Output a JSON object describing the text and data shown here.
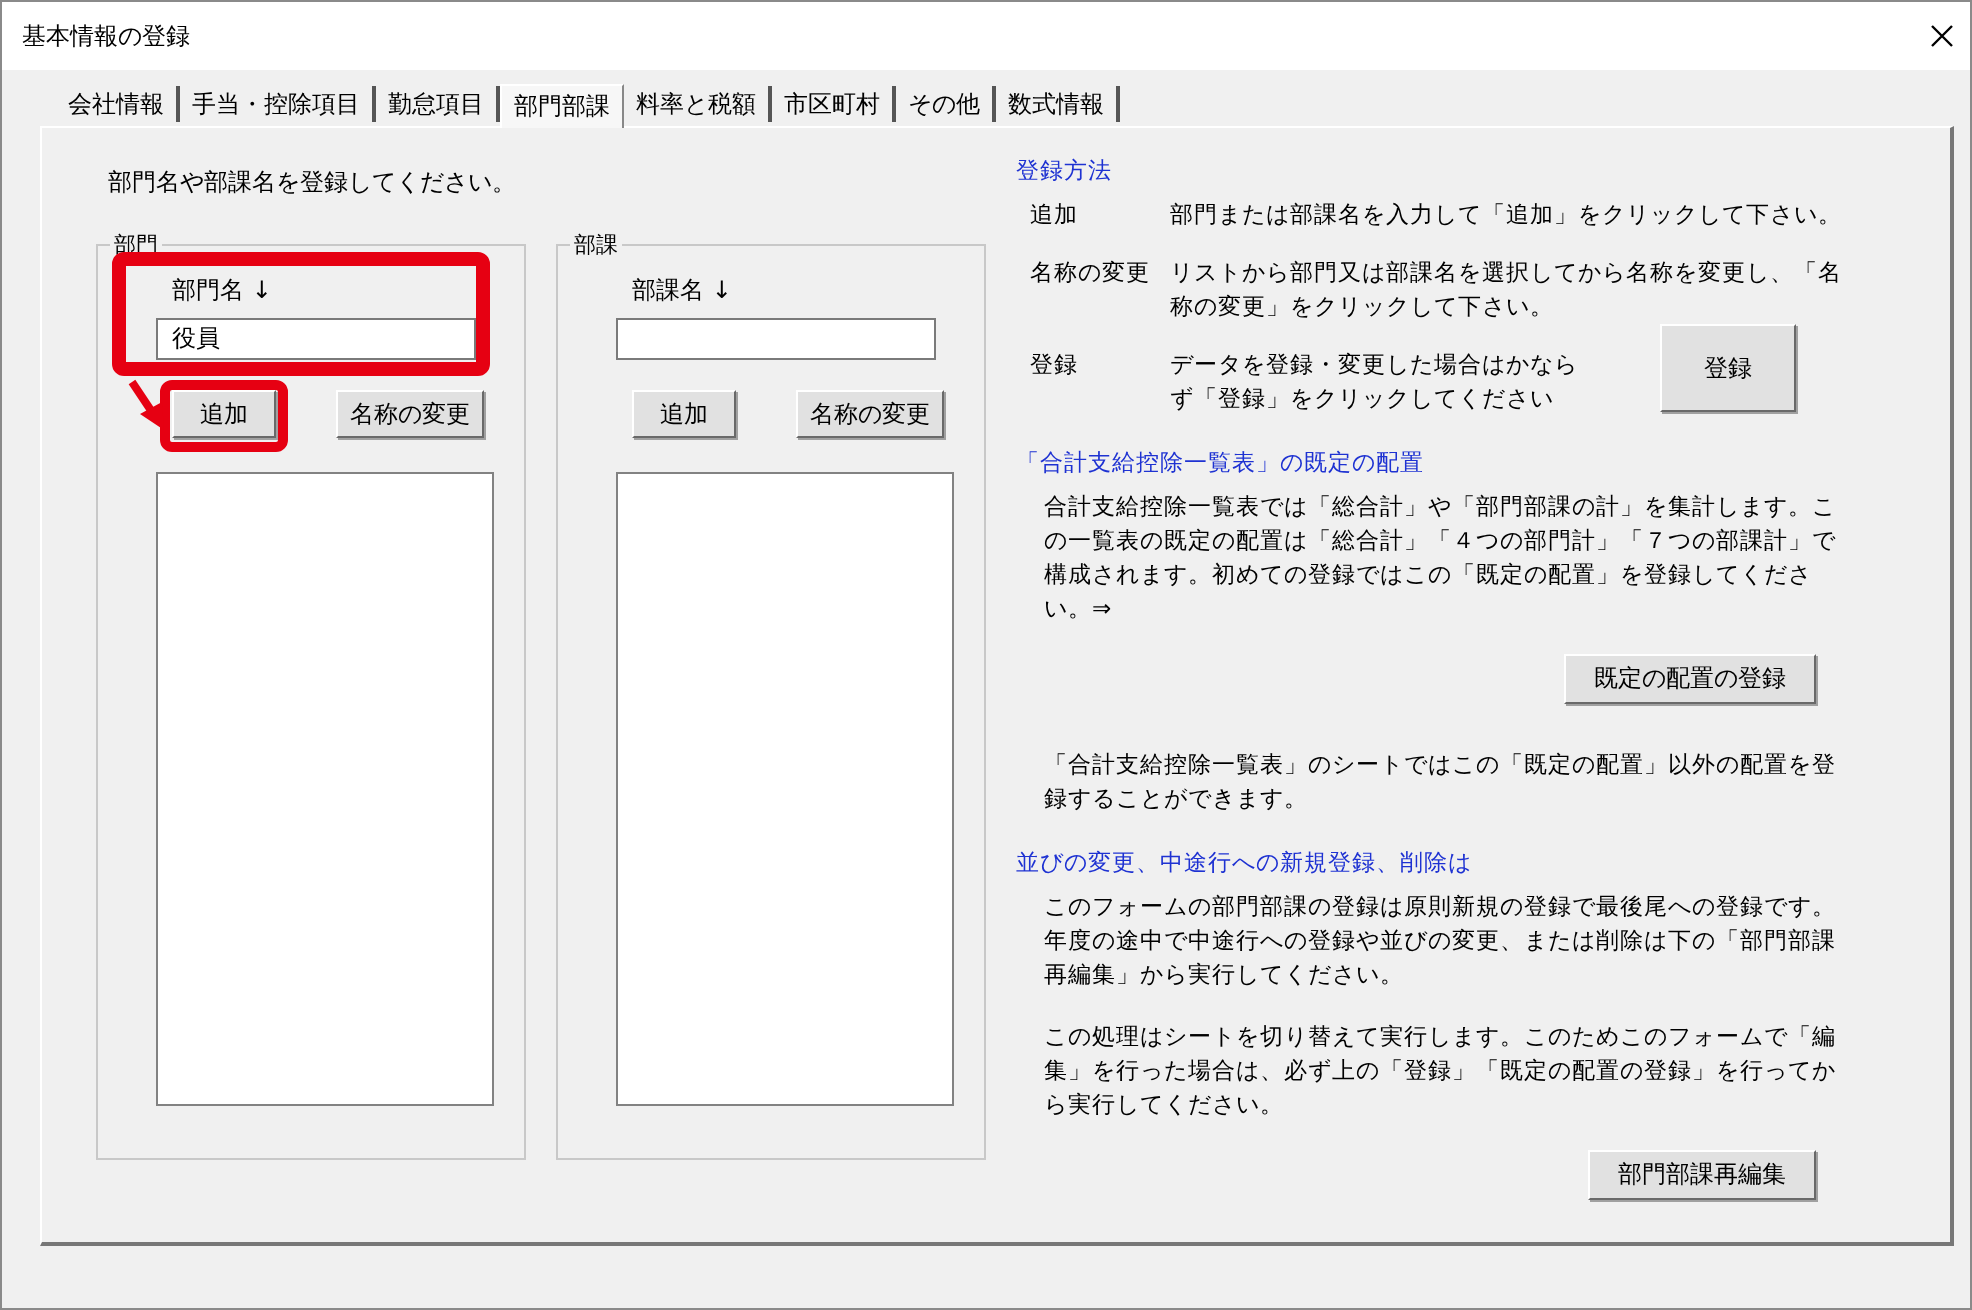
{
  "window": {
    "title": "基本情報の登録"
  },
  "tabs": [
    {
      "label": "会社情報",
      "selected": false
    },
    {
      "label": "手当・控除項目",
      "selected": false
    },
    {
      "label": "勤怠項目",
      "selected": false
    },
    {
      "label": "部門部課",
      "selected": true
    },
    {
      "label": "料率と税額",
      "selected": false
    },
    {
      "label": "市区町村",
      "selected": false
    },
    {
      "label": "その他",
      "selected": false
    },
    {
      "label": "数式情報",
      "selected": false
    }
  ],
  "instruction": "部門名や部課名を登録してください。",
  "groups": [
    {
      "title": "部門",
      "field_label": "部門名 ↓",
      "field_value": "役員",
      "highlighted": true,
      "buttons": [
        {
          "label": "追加",
          "highlighted": true
        },
        {
          "label": "名称の変更",
          "highlighted": false
        }
      ]
    },
    {
      "title": "部課",
      "field_label": "部課名 ↓",
      "highlighted": false,
      "buttons": [
        {
          "label": "追加",
          "highlighted": false
        },
        {
          "label": "名称の変更",
          "highlighted": false
        }
      ]
    }
  ],
  "help": [
    {
      "kind": "heading",
      "text": "登録方法"
    },
    {
      "kind": "definition",
      "term": "追加",
      "text": "部門または部課名を入力して「追加」をクリックして下さい。"
    },
    {
      "kind": "definition",
      "term": "名称の変更",
      "text": "リストから部門又は部課名を選択してから名称を変更し、「名称の変更」をクリックして下さい。"
    },
    {
      "kind": "definition",
      "term": "登録",
      "text": "データを登録・変更した場合はかならず「登録」をクリックしてください",
      "button": "登録"
    },
    {
      "kind": "heading",
      "text": "「合計支給控除一覧表」の既定の配置"
    },
    {
      "kind": "paragraph",
      "text": "合計支給控除一覧表では「総合計」や「部門部課の計」を集計します。この一覧表の既定の配置は「総合計」「４つの部門計」「７つの部課計」で構成されます。初めての登録ではこの「既定の配置」を登録してください。⇒"
    },
    {
      "kind": "button",
      "text": "既定の配置の登録"
    },
    {
      "kind": "paragraph",
      "text": "「合計支給控除一覧表」のシートではこの「既定の配置」以外の配置を登録することができます。"
    },
    {
      "kind": "heading",
      "text": "並びの変更、中途行への新規登録、削除は"
    },
    {
      "kind": "paragraph",
      "text": "このフォームの部門部課の登録は原則新規の登録で最後尾への登録です。年度の途中で中途行への登録や並びの変更、または削除は下の「部門部課再編集」から実行してください。"
    },
    {
      "kind": "paragraph",
      "text": "この処理はシートを切り替えて実行します。このためこのフォームで「編集」を行った場合は、必ず上の「登録」「既定の配置の登録」を行ってから実行してください。"
    },
    {
      "kind": "button",
      "text": "部門部課再編集"
    }
  ]
}
